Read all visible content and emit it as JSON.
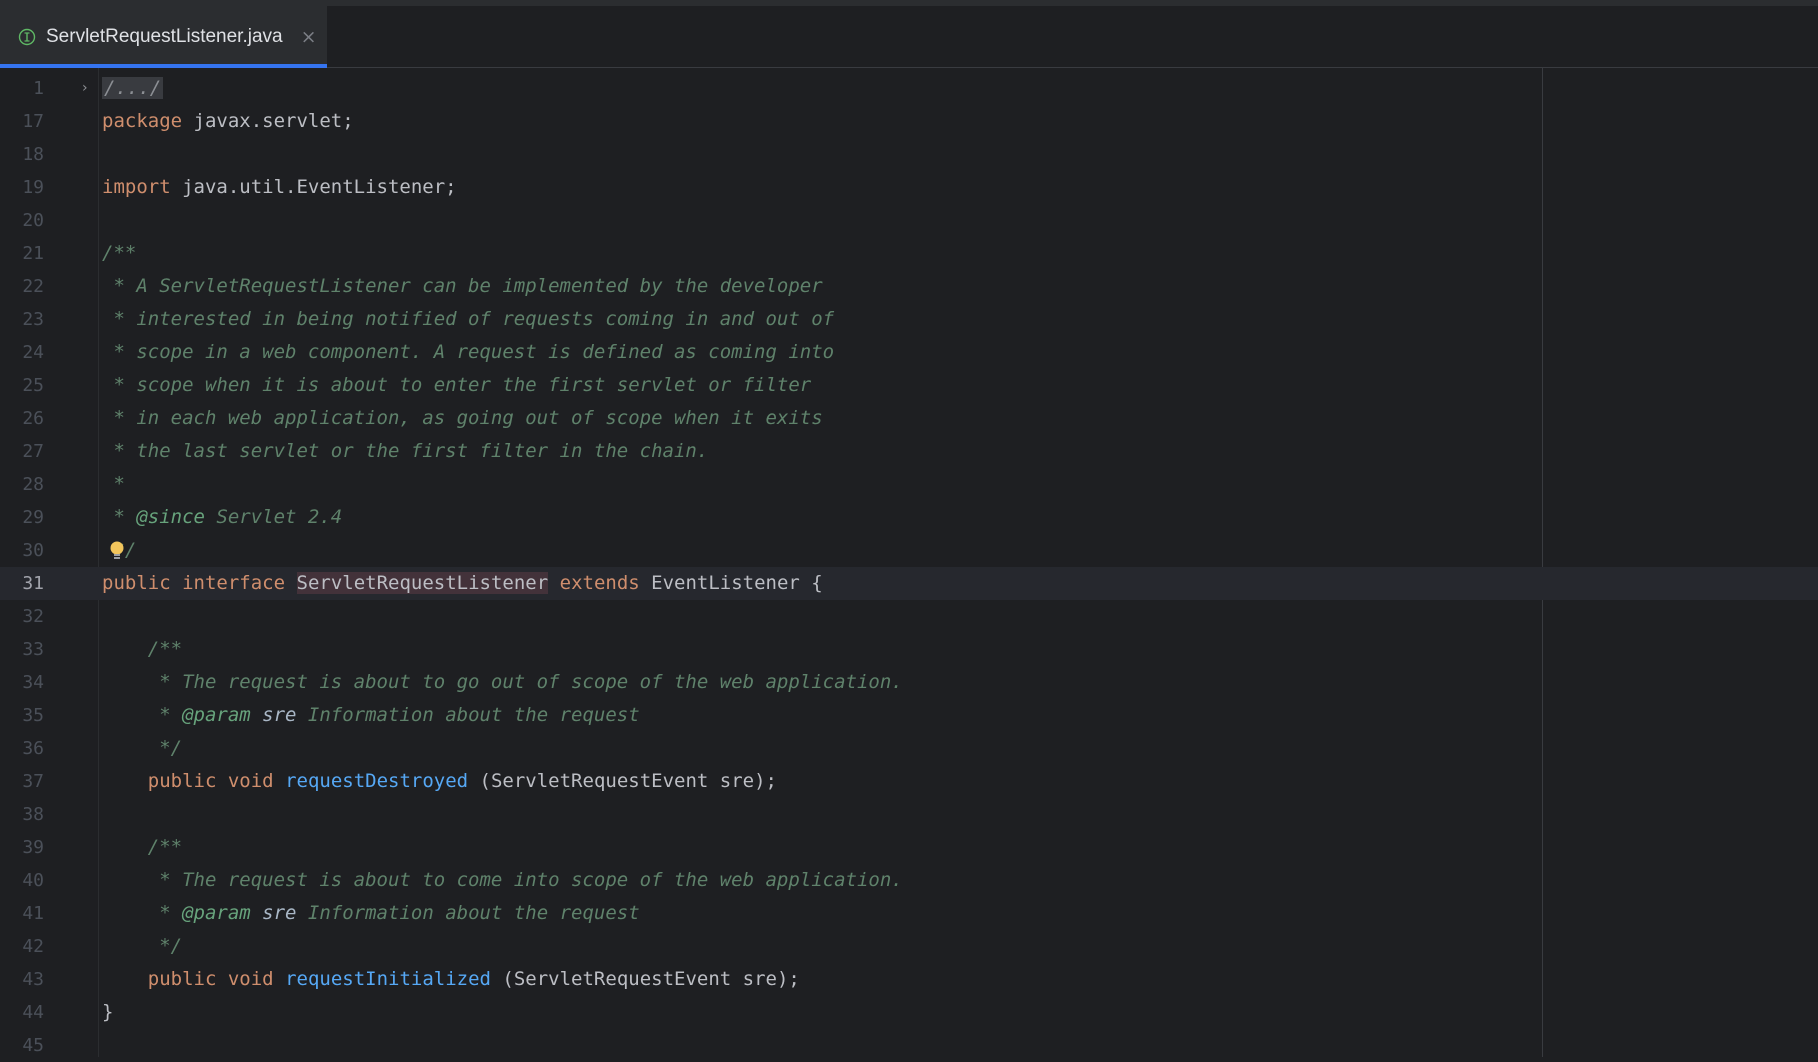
{
  "tab": {
    "label": "ServletRequestListener.java",
    "close": "×",
    "icon": "interface-icon"
  },
  "editor": {
    "fold_marker": "›",
    "lines": [
      {
        "n": "1",
        "parts": [
          {
            "t": "/.../",
            "c": "folded"
          }
        ]
      },
      {
        "n": "17",
        "parts": [
          {
            "t": "package",
            "c": "kw"
          },
          {
            "t": " javax.servlet;",
            "c": "plain"
          }
        ]
      },
      {
        "n": "18",
        "parts": []
      },
      {
        "n": "19",
        "parts": [
          {
            "t": "import",
            "c": "kw"
          },
          {
            "t": " java.util.EventListener;",
            "c": "plain"
          }
        ]
      },
      {
        "n": "20",
        "parts": []
      },
      {
        "n": "21",
        "parts": [
          {
            "t": "/**",
            "c": "cm"
          }
        ]
      },
      {
        "n": "22",
        "parts": [
          {
            "t": " * A ServletRequestListener can be implemented by the developer",
            "c": "cm"
          }
        ]
      },
      {
        "n": "23",
        "parts": [
          {
            "t": " * interested in being notified of requests coming in and out of",
            "c": "cm"
          }
        ]
      },
      {
        "n": "24",
        "parts": [
          {
            "t": " * scope in a web component. A request is defined as coming into",
            "c": "cm"
          }
        ]
      },
      {
        "n": "25",
        "parts": [
          {
            "t": " * scope when it is about to enter the first servlet or filter",
            "c": "cm"
          }
        ]
      },
      {
        "n": "26",
        "parts": [
          {
            "t": " * in each web application, as going out of scope when it exits",
            "c": "cm"
          }
        ]
      },
      {
        "n": "27",
        "parts": [
          {
            "t": " * the last servlet or the first filter in the chain.",
            "c": "cm"
          }
        ]
      },
      {
        "n": "28",
        "parts": [
          {
            "t": " *",
            "c": "cm"
          }
        ]
      },
      {
        "n": "29",
        "parts": [
          {
            "t": " * ",
            "c": "cm"
          },
          {
            "t": "@since",
            "c": "tag"
          },
          {
            "t": " Servlet 2.4",
            "c": "cm"
          }
        ]
      },
      {
        "n": "30",
        "parts": [
          {
            "t": " */",
            "c": "cm"
          }
        ],
        "bulb": true
      },
      {
        "n": "31",
        "current": true,
        "parts": [
          {
            "t": "public",
            "c": "kw"
          },
          {
            "t": " ",
            "c": "plain"
          },
          {
            "t": "interface",
            "c": "kw"
          },
          {
            "t": " ",
            "c": "plain"
          },
          {
            "t": "ServletRequestListener",
            "c": "hl"
          },
          {
            "t": " ",
            "c": "plain"
          },
          {
            "t": "extends",
            "c": "kw"
          },
          {
            "t": " EventListener {",
            "c": "plain"
          }
        ]
      },
      {
        "n": "32",
        "parts": []
      },
      {
        "n": "33",
        "parts": [
          {
            "t": "    /**",
            "c": "cm"
          }
        ]
      },
      {
        "n": "34",
        "parts": [
          {
            "t": "     * The request is about to go out of scope of the web application.",
            "c": "cm"
          }
        ]
      },
      {
        "n": "35",
        "parts": [
          {
            "t": "     * ",
            "c": "cm"
          },
          {
            "t": "@param",
            "c": "tag"
          },
          {
            "t": " sre",
            "c": "pn"
          },
          {
            "t": " Information about the request",
            "c": "cm"
          }
        ]
      },
      {
        "n": "36",
        "parts": [
          {
            "t": "     */",
            "c": "cm"
          }
        ]
      },
      {
        "n": "37",
        "parts": [
          {
            "t": "    ",
            "c": "plain"
          },
          {
            "t": "public",
            "c": "kw"
          },
          {
            "t": " ",
            "c": "plain"
          },
          {
            "t": "void",
            "c": "kw"
          },
          {
            "t": " ",
            "c": "plain"
          },
          {
            "t": "requestDestroyed",
            "c": "fn"
          },
          {
            "t": " (ServletRequestEvent sre);",
            "c": "plain"
          }
        ]
      },
      {
        "n": "38",
        "parts": []
      },
      {
        "n": "39",
        "parts": [
          {
            "t": "    /**",
            "c": "cm"
          }
        ]
      },
      {
        "n": "40",
        "parts": [
          {
            "t": "     * The request is about to come into scope of the web application.",
            "c": "cm"
          }
        ]
      },
      {
        "n": "41",
        "parts": [
          {
            "t": "     * ",
            "c": "cm"
          },
          {
            "t": "@param",
            "c": "tag"
          },
          {
            "t": " sre",
            "c": "pn"
          },
          {
            "t": " Information about the request",
            "c": "cm"
          }
        ]
      },
      {
        "n": "42",
        "parts": [
          {
            "t": "     */",
            "c": "cm"
          }
        ]
      },
      {
        "n": "43",
        "parts": [
          {
            "t": "    ",
            "c": "plain"
          },
          {
            "t": "public",
            "c": "kw"
          },
          {
            "t": " ",
            "c": "plain"
          },
          {
            "t": "void",
            "c": "kw"
          },
          {
            "t": " ",
            "c": "plain"
          },
          {
            "t": "requestInitialized",
            "c": "fn"
          },
          {
            "t": " (ServletRequestEvent sre);",
            "c": "plain"
          }
        ]
      },
      {
        "n": "44",
        "parts": [
          {
            "t": "}",
            "c": "plain"
          }
        ]
      },
      {
        "n": "45",
        "parts": []
      }
    ]
  },
  "colors": {
    "background": "#1e1f22",
    "tab_active_bg": "#2b2d30",
    "tab_underline": "#3574f0",
    "keyword": "#cf8e6d",
    "comment": "#5f826b",
    "doc_tag": "#67a37c",
    "method": "#56a8f5",
    "text": "#bcbec4",
    "highlight_bg": "#43323a"
  }
}
